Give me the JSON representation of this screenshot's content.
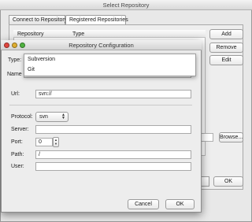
{
  "outer_window": {
    "title": "Select Repository",
    "tabs": [
      {
        "label": "Connect to Repository"
      },
      {
        "label": "Registered Repositories"
      }
    ],
    "table": {
      "columns": [
        "Repository",
        "Type"
      ]
    },
    "buttons": {
      "add": "Add",
      "remove": "Remove",
      "edit": "Edit",
      "browse": "Browse...",
      "ok": "OK"
    }
  },
  "dialog": {
    "title": "Repository Configuration",
    "labels": {
      "type": "Type:",
      "name": "Name",
      "url": "Url:",
      "protocol": "Protocol:",
      "server": "Server:",
      "port": "Port:",
      "path": "Path:",
      "user": "User:"
    },
    "fields": {
      "url": "svn://",
      "protocol": "svn",
      "port": "0",
      "path": "/"
    },
    "type_options": [
      "Subversion",
      "Git"
    ],
    "buttons": {
      "cancel": "Cancel",
      "ok": "OK"
    }
  }
}
